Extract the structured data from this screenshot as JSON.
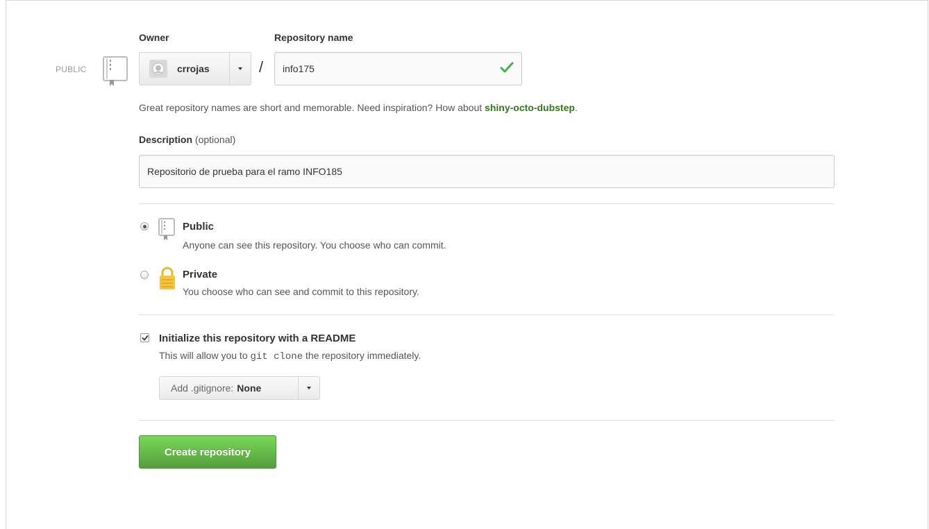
{
  "visibility_tag": "PUBLIC",
  "owner": {
    "label": "Owner",
    "name": "crrojas"
  },
  "repo_name": {
    "label": "Repository name",
    "value": "info175",
    "separator": "/"
  },
  "name_hint": {
    "prefix": "Great repository names are short and memorable. Need inspiration? How about ",
    "suggestion": "shiny-octo-dubstep",
    "suffix": "."
  },
  "description": {
    "label": "Description",
    "optional": "(optional)",
    "value": "Repositorio de prueba para el ramo INFO185"
  },
  "visibility_options": [
    {
      "title": "Public",
      "desc": "Anyone can see this repository. You choose who can commit.",
      "selected": true
    },
    {
      "title": "Private",
      "desc": "You choose who can see and commit to this repository.",
      "selected": false
    }
  ],
  "readme": {
    "label": "Initialize this repository with a README",
    "desc_before": "This will allow you to ",
    "code": "git clone",
    "desc_after": " the repository immediately.",
    "checked": true
  },
  "gitignore": {
    "prefix": "Add .gitignore:",
    "value": "None"
  },
  "create_button": "Create repository",
  "colors": {
    "accent_green": "#2f7a16",
    "button_green": "#60b044",
    "check_green": "#39b54a",
    "lock_yellow": "#f5c542"
  }
}
